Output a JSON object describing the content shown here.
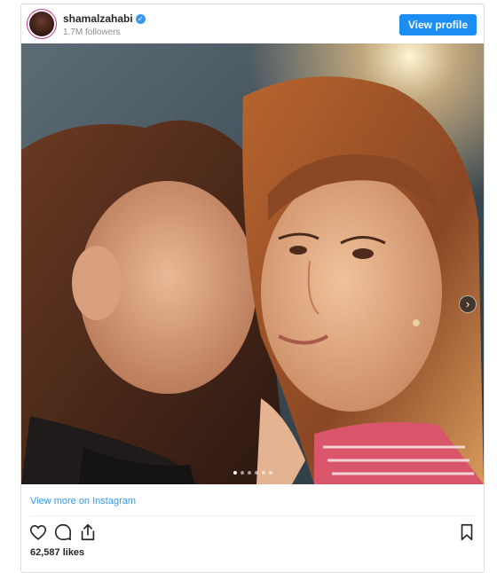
{
  "header": {
    "username": "shamalzahabi",
    "followers": "1.7M followers",
    "view_profile_label": "View profile"
  },
  "post": {
    "current_slide": 1,
    "slide_count": 6,
    "view_more_label": "View more on Instagram",
    "likes_text": "62,587 likes"
  },
  "icons": {
    "verified": "verified-badge-icon",
    "next": "chevron-right-icon",
    "like": "heart-icon",
    "comment": "comment-icon",
    "share": "share-icon",
    "save": "bookmark-icon"
  },
  "colors": {
    "accent": "#1c8ef2",
    "link": "#3897f0"
  }
}
